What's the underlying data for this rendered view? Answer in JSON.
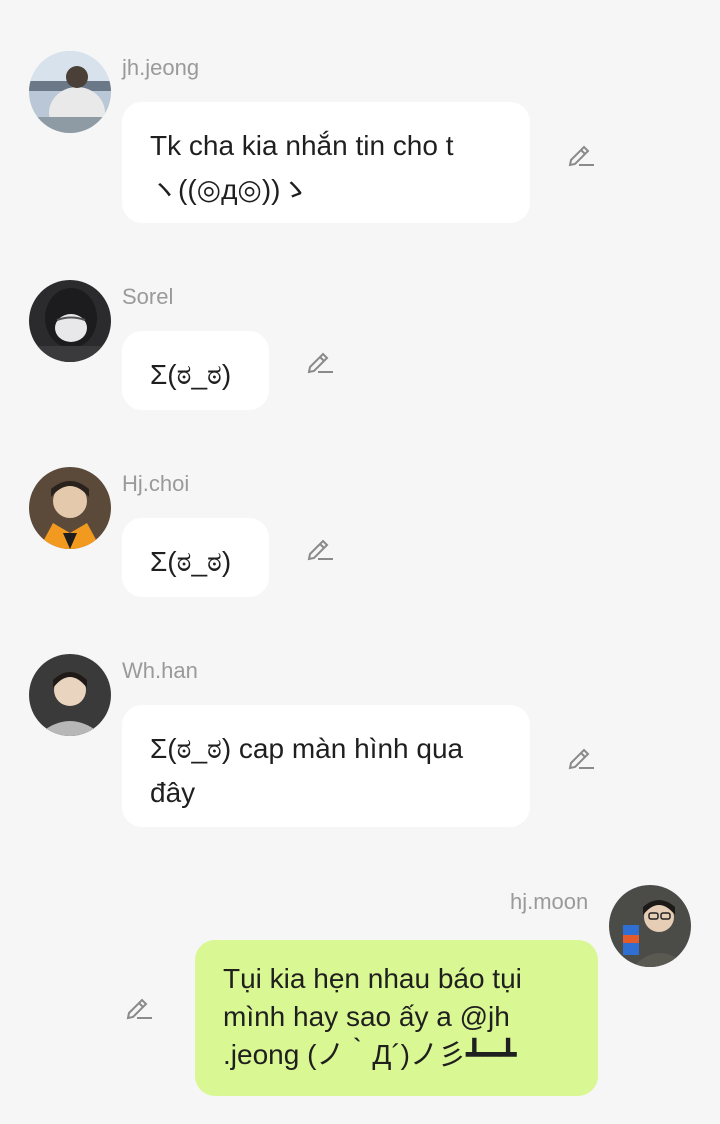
{
  "messages": [
    {
      "sender": "jh.jeong",
      "side": "left",
      "lines": [
        "Tk cha kia nhắn tin cho t",
        "ヽ((◎д◎))ゝ"
      ]
    },
    {
      "sender": "Sorel",
      "side": "left",
      "lines": [
        "Σ(ಠ_ಠ)"
      ]
    },
    {
      "sender": "Hj.choi",
      "side": "left",
      "lines": [
        "Σ(ಠ_ಠ)"
      ]
    },
    {
      "sender": "Wh.han",
      "side": "left",
      "lines": [
        "Σ(ಠ_ಠ) cap màn hình qua",
        "đây"
      ]
    },
    {
      "sender": "hj.moon",
      "side": "right",
      "lines": [
        "Tụi kia hẹn nhau báo tụi",
        "mình hay sao ấy a @jh",
        ".jeong (ノ｀Д´)ノ彡┻━┻"
      ]
    }
  ],
  "colors": {
    "background": "#f6f6f6",
    "bubble_other": "#ffffff",
    "bubble_mine": "#d9f792",
    "name_text": "#9a9a9a",
    "message_text": "#1f1f1f",
    "edit_icon": "#8a8a8a"
  },
  "icons": {
    "edit": "pencil-icon",
    "avatar": "user-photo-avatar"
  }
}
